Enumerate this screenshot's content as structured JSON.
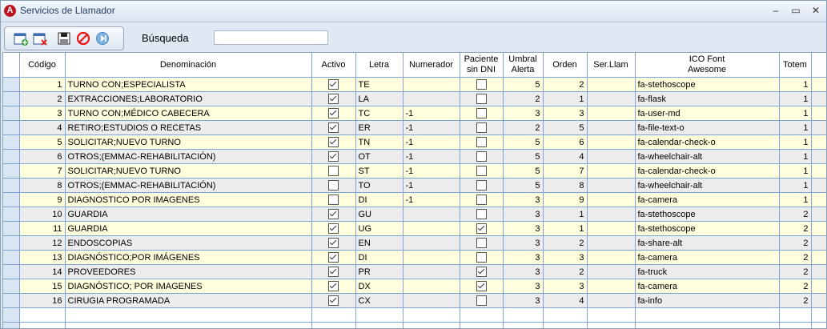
{
  "window": {
    "title": "Servicios de Llamador"
  },
  "toolbar": {
    "search_label": "Búsqueda",
    "search_value": ""
  },
  "columns": [
    "",
    "Código",
    "Denominación",
    "Activo",
    "Letra",
    "Numerador",
    "Paciente\nsin DNI",
    "Umbral\nAlerta",
    "Orden",
    "Ser.Llam",
    "ICO Font\nAwesome",
    "Totem",
    ""
  ],
  "rows": [
    {
      "codigo": "1",
      "denominacion": "TURNO CON;ESPECIALISTA",
      "activo": true,
      "letra": "TE",
      "numerador": "",
      "sin_dni": false,
      "umbral": "5",
      "orden": "2",
      "serllam": "",
      "ico": "fa-stethoscope",
      "totem": "1"
    },
    {
      "codigo": "2",
      "denominacion": "EXTRACCIONES;LABORATORIO",
      "activo": true,
      "letra": "LA",
      "numerador": "",
      "sin_dni": false,
      "umbral": "2",
      "orden": "1",
      "serllam": "",
      "ico": "fa-flask",
      "totem": "1"
    },
    {
      "codigo": "3",
      "denominacion": "TURNO CON;MÉDICO CABECERA",
      "activo": true,
      "letra": "TC",
      "numerador": "-1",
      "sin_dni": false,
      "umbral": "3",
      "orden": "3",
      "serllam": "",
      "ico": "fa-user-md",
      "totem": "1"
    },
    {
      "codigo": "4",
      "denominacion": "RETIRO;ESTUDIOS O RECETAS",
      "activo": true,
      "letra": "ER",
      "numerador": "-1",
      "sin_dni": false,
      "umbral": "2",
      "orden": "5",
      "serllam": "",
      "ico": "fa-file-text-o",
      "totem": "1"
    },
    {
      "codigo": "5",
      "denominacion": "SOLICITAR;NUEVO TURNO",
      "activo": true,
      "letra": "TN",
      "numerador": "-1",
      "sin_dni": false,
      "umbral": "5",
      "orden": "6",
      "serllam": "",
      "ico": "fa-calendar-check-o",
      "totem": "1"
    },
    {
      "codigo": "6",
      "denominacion": "OTROS;(EMMAC-REHABILITACIÓN)",
      "activo": true,
      "letra": "OT",
      "numerador": "-1",
      "sin_dni": false,
      "umbral": "5",
      "orden": "4",
      "serllam": "",
      "ico": "fa-wheelchair-alt",
      "totem": "1"
    },
    {
      "codigo": "7",
      "denominacion": "SOLICITAR;NUEVO TURNO",
      "activo": false,
      "letra": "ST",
      "numerador": "-1",
      "sin_dni": false,
      "umbral": "5",
      "orden": "7",
      "serllam": "",
      "ico": "fa-calendar-check-o",
      "totem": "1"
    },
    {
      "codigo": "8",
      "denominacion": "OTROS;(EMMAC-REHABILITACIÓN)",
      "activo": false,
      "letra": "TO",
      "numerador": "-1",
      "sin_dni": false,
      "umbral": "5",
      "orden": "8",
      "serllam": "",
      "ico": "fa-wheelchair-alt",
      "totem": "1"
    },
    {
      "codigo": "9",
      "denominacion": "DIAGNOSTICO POR IMAGENES",
      "activo": false,
      "letra": "DI",
      "numerador": "-1",
      "sin_dni": false,
      "umbral": "3",
      "orden": "9",
      "serllam": "",
      "ico": "fa-camera",
      "totem": "1"
    },
    {
      "codigo": "10",
      "denominacion": "GUARDIA",
      "activo": true,
      "letra": "GU",
      "numerador": "",
      "sin_dni": false,
      "umbral": "3",
      "orden": "1",
      "serllam": "",
      "ico": "fa-stethoscope",
      "totem": "2"
    },
    {
      "codigo": "11",
      "denominacion": "GUARDIA",
      "activo": true,
      "letra": "UG",
      "numerador": "",
      "sin_dni": true,
      "umbral": "3",
      "orden": "1",
      "serllam": "",
      "ico": "fa-stethoscope",
      "totem": "2"
    },
    {
      "codigo": "12",
      "denominacion": "ENDOSCOPIAS",
      "activo": true,
      "letra": "EN",
      "numerador": "",
      "sin_dni": false,
      "umbral": "3",
      "orden": "2",
      "serllam": "",
      "ico": "fa-share-alt",
      "totem": "2"
    },
    {
      "codigo": "13",
      "denominacion": "DIAGNÓSTICO;POR IMÁGENES",
      "activo": true,
      "letra": "DI",
      "numerador": "",
      "sin_dni": false,
      "umbral": "3",
      "orden": "3",
      "serllam": "",
      "ico": "fa-camera",
      "totem": "2"
    },
    {
      "codigo": "14",
      "denominacion": "PROVEEDORES",
      "activo": true,
      "letra": "PR",
      "numerador": "",
      "sin_dni": true,
      "umbral": "3",
      "orden": "2",
      "serllam": "",
      "ico": "fa-truck",
      "totem": "2"
    },
    {
      "codigo": "15",
      "denominacion": "DIAGNÓSTICO; POR IMAGENES",
      "activo": true,
      "letra": "DX",
      "numerador": "",
      "sin_dni": true,
      "umbral": "3",
      "orden": "3",
      "serllam": "",
      "ico": "fa-camera",
      "totem": "2"
    },
    {
      "codigo": "16",
      "denominacion": "CIRUGIA PROGRAMADA",
      "activo": true,
      "letra": "CX",
      "numerador": "",
      "sin_dni": false,
      "umbral": "3",
      "orden": "4",
      "serllam": "",
      "ico": "fa-info",
      "totem": "2"
    }
  ]
}
